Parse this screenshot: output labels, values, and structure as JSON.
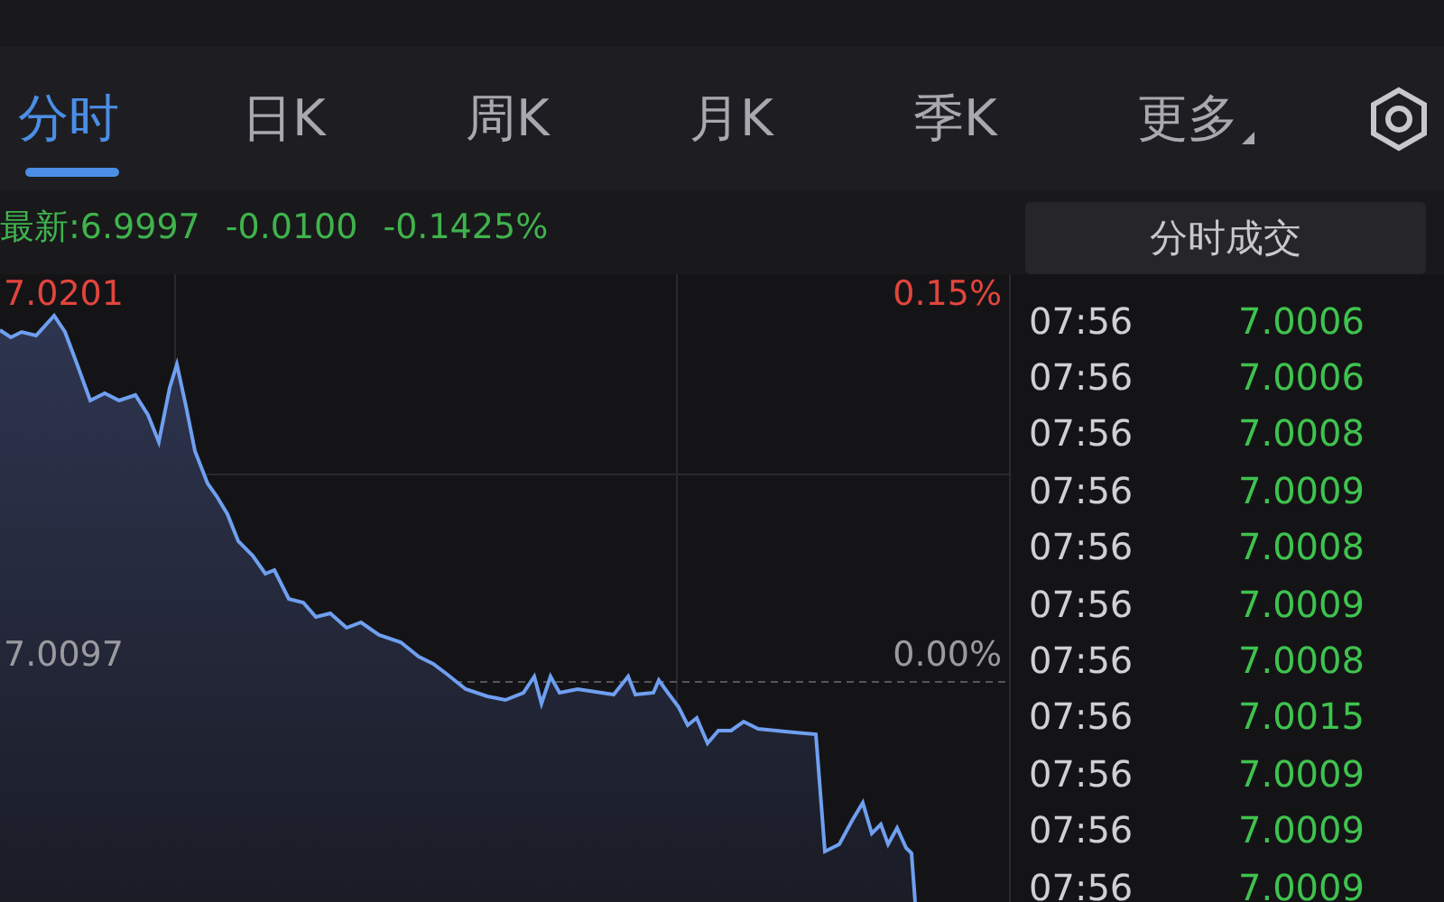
{
  "tabs": [
    {
      "label": "分时",
      "selected": true
    },
    {
      "label": "日K",
      "selected": false
    },
    {
      "label": "周K",
      "selected": false
    },
    {
      "label": "月K",
      "selected": false
    },
    {
      "label": "季K",
      "selected": false
    },
    {
      "label": "更多",
      "selected": false,
      "kind": "dropdown"
    }
  ],
  "quote": {
    "latest": "最新:6.9997",
    "change": "-0.0100",
    "change_pct": "-0.1425%"
  },
  "chart": {
    "high_price": "7.0201",
    "high_pct": "0.15%",
    "base_price": "7.0097",
    "base_pct": "0.00%"
  },
  "trades": {
    "title": "分时成交",
    "rows": [
      {
        "time": "07:56",
        "price": "7.0006"
      },
      {
        "time": "07:56",
        "price": "7.0006"
      },
      {
        "time": "07:56",
        "price": "7.0008"
      },
      {
        "time": "07:56",
        "price": "7.0009"
      },
      {
        "time": "07:56",
        "price": "7.0008"
      },
      {
        "time": "07:56",
        "price": "7.0009"
      },
      {
        "time": "07:56",
        "price": "7.0008"
      },
      {
        "time": "07:56",
        "price": "7.0015"
      },
      {
        "time": "07:56",
        "price": "7.0009"
      },
      {
        "time": "07:56",
        "price": "7.0009"
      },
      {
        "time": "07:56",
        "price": "7.0009"
      }
    ]
  }
}
